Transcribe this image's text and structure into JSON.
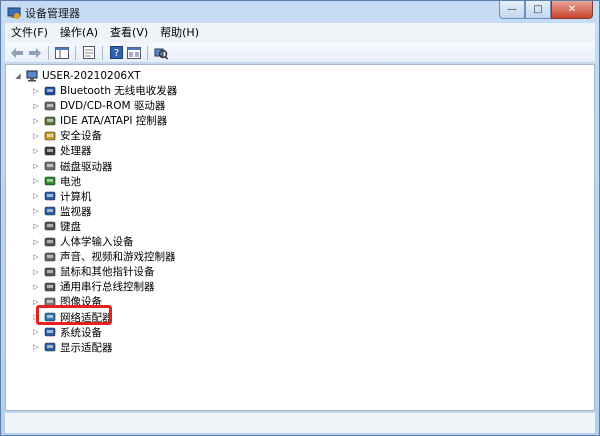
{
  "window": {
    "title": "设备管理器"
  },
  "menu": [
    "文件(F)",
    "操作(A)",
    "查看(V)",
    "帮助(H)"
  ],
  "tree": {
    "root": "USER-20210206XT",
    "items": [
      {
        "label": "Bluetooth 无线电收发器",
        "icon": "bluetooth-icon",
        "color": "#1a4fa0"
      },
      {
        "label": "DVD/CD-ROM 驱动器",
        "icon": "dvd-drive-icon",
        "color": "#6a6a6a"
      },
      {
        "label": "IDE ATA/ATAPI 控制器",
        "icon": "ide-controller-icon",
        "color": "#5a7a3a"
      },
      {
        "label": "安全设备",
        "icon": "security-device-icon",
        "color": "#c8a020"
      },
      {
        "label": "处理器",
        "icon": "processor-icon",
        "color": "#3a3a3a"
      },
      {
        "label": "磁盘驱动器",
        "icon": "disk-drive-icon",
        "color": "#707070"
      },
      {
        "label": "电池",
        "icon": "battery-icon",
        "color": "#2e8b2e"
      },
      {
        "label": "计算机",
        "icon": "computer-icon",
        "color": "#2d5fa8"
      },
      {
        "label": "监视器",
        "icon": "monitor-icon",
        "color": "#2d5fa8"
      },
      {
        "label": "键盘",
        "icon": "keyboard-icon",
        "color": "#555555"
      },
      {
        "label": "人体学输入设备",
        "icon": "hid-icon",
        "color": "#555555"
      },
      {
        "label": "声音、视频和游戏控制器",
        "icon": "sound-icon",
        "color": "#666666"
      },
      {
        "label": "鼠标和其他指针设备",
        "icon": "mouse-icon",
        "color": "#555555"
      },
      {
        "label": "通用串行总线控制器",
        "icon": "usb-icon",
        "color": "#555555"
      },
      {
        "label": "图像设备",
        "icon": "imaging-device-icon",
        "color": "#777777"
      },
      {
        "label": "网络适配器",
        "icon": "network-adapter-icon",
        "color": "#2a7ab8"
      },
      {
        "label": "系统设备",
        "icon": "system-device-icon",
        "color": "#2d5fa8"
      },
      {
        "label": "显示适配器",
        "icon": "display-adapter-icon",
        "color": "#2d5fa8"
      }
    ]
  },
  "highlight_color": "#e8201e"
}
